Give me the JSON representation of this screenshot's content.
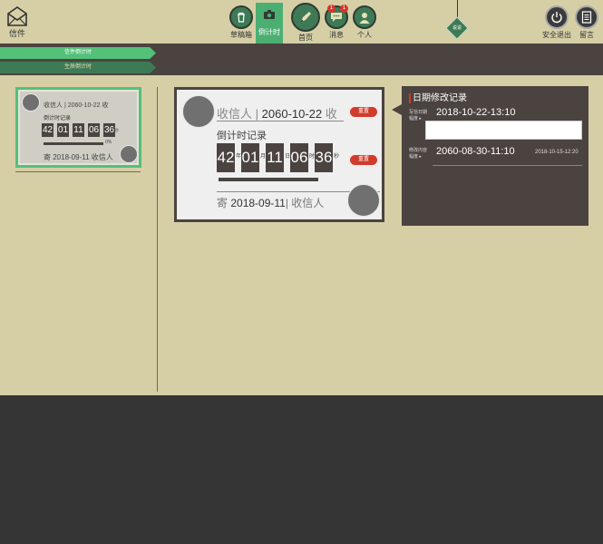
{
  "header": {
    "logo_label": "信件",
    "nav": [
      {
        "label": "草稿箱",
        "icon": "trash-icon"
      },
      {
        "label": "倒计时",
        "icon": "camera-icon"
      },
      {
        "label": "首页",
        "icon": "pen-icon"
      },
      {
        "label": "消息",
        "icon": "chat-icon",
        "badges": [
          "1",
          "1"
        ]
      },
      {
        "label": "个人",
        "icon": "person-icon"
      }
    ],
    "tag_label": "说说",
    "logout_label": "安全退出",
    "message_label": "留言"
  },
  "tabs": [
    {
      "label": "信件倒计时"
    },
    {
      "label": "生辰倒计时"
    }
  ],
  "small_card": {
    "to_line": "收信人 | 2060-10-22 收",
    "countdown_title": "倒计时记录",
    "digits": [
      "42",
      "01",
      "11",
      "06",
      "36"
    ],
    "sec_unit": "秒",
    "percent": "0%",
    "from_line": "寄 2018-09-11 收信人"
  },
  "big_card": {
    "to_prefix": "收信人 |",
    "to_date": "2060-10-22",
    "to_suffix": "收",
    "reset_label": "重置",
    "countdown_title": "倒计时记录",
    "digits": [
      "42",
      "01",
      "11",
      "06",
      "36"
    ],
    "units": [
      "年",
      "月",
      "日",
      "时",
      "秒"
    ],
    "from_prefix": "寄",
    "from_date": "2018-09-11",
    "from_suffix": "| 收信人"
  },
  "history": {
    "title": "日期修改记录",
    "write_date_label": [
      "写信日期",
      "幅度 ▸"
    ],
    "write_date_value": "2018-10-22-13:10",
    "modify_label": [
      "修改内容",
      "幅度 ▸"
    ],
    "modify_value": "2060-08-30-11:10",
    "modify_time": "2018-10-15-12:20"
  },
  "colors": {
    "accent_green": "#53c178",
    "dark_green": "#3e7a55",
    "dark_brown": "#4a4340",
    "cream": "#d6cfa6",
    "reset_red": "#d23a2b"
  }
}
